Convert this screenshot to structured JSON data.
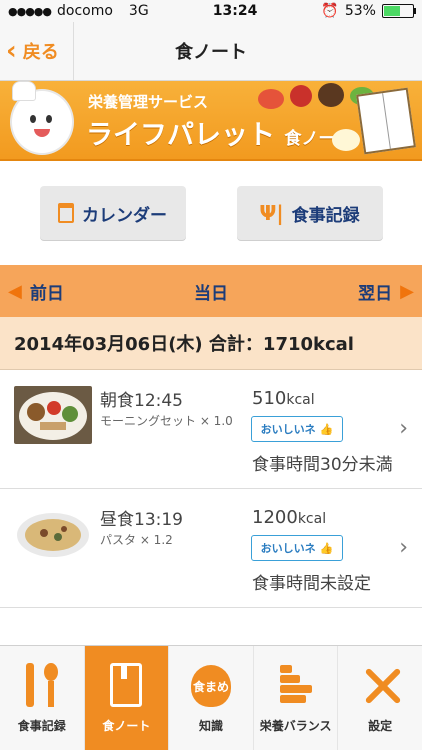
{
  "status_bar": {
    "carrier": "docomo",
    "network": "3G",
    "time": "13:24",
    "battery": "53%",
    "battery_fill": 0.53,
    "signal_dots": "●●●●●"
  },
  "nav": {
    "back_label": "戻る",
    "back_chevron": "‹",
    "title": "食ノート"
  },
  "banner": {
    "subtitle": "栄養管理サービス",
    "title": "ライフパレット",
    "title_small": "食ノート"
  },
  "toolbar": {
    "calendar_label": "カレンダー",
    "meal_record_label": "食事記録",
    "meal_record_icon": "Ψ|"
  },
  "day_nav": {
    "prev": "前日",
    "today": "当日",
    "next": "翌日",
    "prev_arrow": "◀",
    "next_arrow": "▶"
  },
  "date_summary": "2014年03月06日(木) 合計：1710kcal",
  "meals": [
    {
      "name": "朝食12:45",
      "desc": "モーニングセット × 1.0",
      "kcal": "510",
      "kcal_unit": "kcal",
      "oishii_label": "おいしいネ",
      "oishii_icon": "👍",
      "time_status": "食事時間30分未満",
      "chevron": "›"
    },
    {
      "name": "昼食13:19",
      "desc": "パスタ × 1.2",
      "kcal": "1200",
      "kcal_unit": "kcal",
      "oishii_label": "おいしいネ",
      "oishii_icon": "👍",
      "time_status": "食事時間未設定",
      "chevron": "›"
    }
  ],
  "tabs": [
    {
      "label": "食事記録",
      "icon": "fork-spoon-icon"
    },
    {
      "label": "食ノート",
      "icon": "notebook-icon",
      "active": true
    },
    {
      "label": "知識",
      "icon": "pear-icon",
      "icon_text": "食まめ"
    },
    {
      "label": "栄養バランス",
      "icon": "bar-chart-icon"
    },
    {
      "label": "設定",
      "icon": "tools-icon"
    }
  ],
  "colors": {
    "accent": "#f08c22",
    "nav_text": "#1c3c79",
    "day_nav_bg": "#f6a55a",
    "date_bg": "#fbe3c8",
    "oishii_border": "#3aa0d8"
  }
}
